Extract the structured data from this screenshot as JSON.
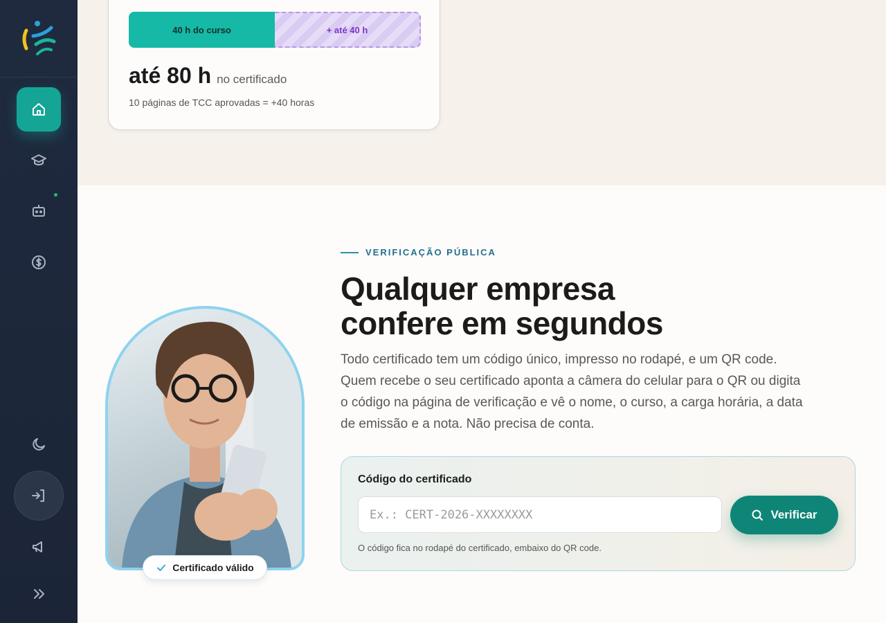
{
  "sidebar": {
    "items": [
      {
        "icon": "home-icon",
        "active": true
      },
      {
        "icon": "graduation-cap-icon",
        "active": false
      },
      {
        "icon": "robot-icon",
        "active": false,
        "notification": true
      },
      {
        "icon": "dollar-circle-icon",
        "active": false
      },
      {
        "icon": "moon-icon",
        "active": false
      },
      {
        "icon": "logout-icon",
        "active": false
      },
      {
        "icon": "megaphone-icon",
        "active": false
      },
      {
        "icon": "chevrons-right-icon",
        "active": false
      }
    ]
  },
  "hours_card": {
    "course_hours_label": "40 h do curso",
    "extra_hours_label": "+ até 40 h",
    "course_fraction": 0.5,
    "total_value": "até 80 h",
    "total_suffix": "no certificado",
    "note": "10 páginas de TCC aprovadas = +40 horas"
  },
  "verification": {
    "eyebrow": "VERIFICAÇÃO PÚBLICA",
    "headline_line1": "Qualquer empresa",
    "headline_line2": "confere em segundos",
    "description": "Todo certificado tem um código único, impresso no rodapé, e um QR code. Quem recebe o seu certificado aponta a câmera do celular para o QR ou digita o código na página de verificação e vê o nome, o curso, a carga horária, a data de emissão e a nota. Não precisa de conta.",
    "badge": "Certificado válido",
    "form": {
      "label": "Código do certificado",
      "placeholder": "Ex.: CERT-2026-XXXXXXXX",
      "value": "",
      "button_label": "Verificar",
      "hint": "O código fica no rodapé do certificado, embaixo do QR code."
    }
  },
  "colors": {
    "sidebar_bg": "#1f2a3f",
    "accent_teal": "#14a596",
    "button_teal": "#0f8577",
    "eyebrow_blue": "#21708e",
    "extra_purple": "#7a35c8"
  }
}
